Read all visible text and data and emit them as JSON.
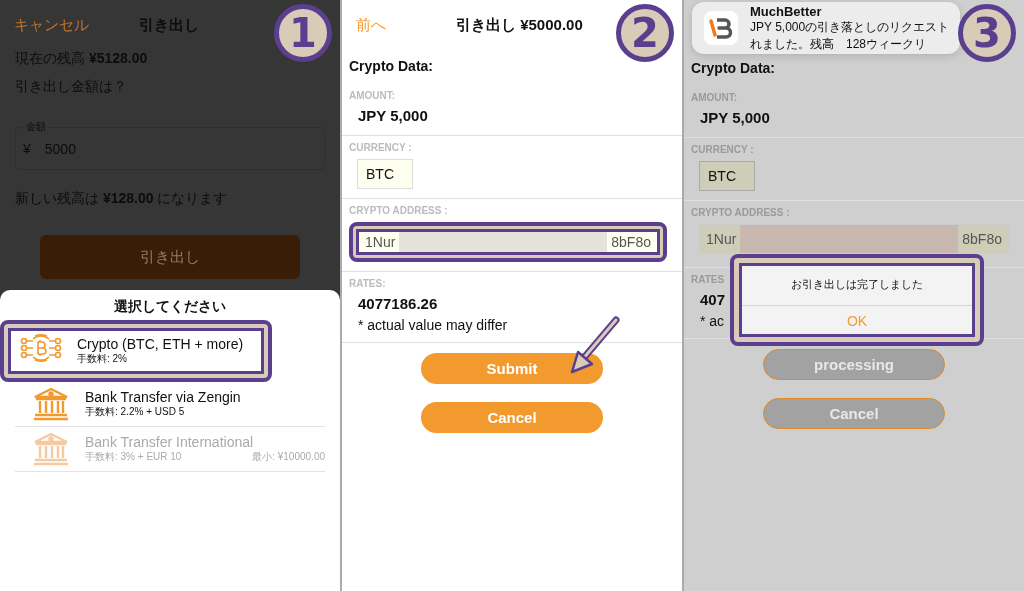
{
  "panels": [
    {
      "kind": "amount",
      "step": "1",
      "dimmed": true,
      "header": {
        "left": "キャンセル",
        "title": "引き出し"
      },
      "balance": "現在の残高 **¥5128.00**",
      "question": "引き出し金額は？",
      "amount_field": {
        "label": "金額",
        "currency": "¥",
        "value": "5000"
      },
      "new_balance": "新しい残高は **¥128.00** になります",
      "button": "引き出し",
      "sheet": {
        "title": "選択してください",
        "options": [
          {
            "kind": "crypto",
            "name": "Crypto (BTC, ETH + more)",
            "fee": "手数料: 2%",
            "disabled": false,
            "highlighted": true
          },
          {
            "kind": "bank",
            "name": "Bank Transfer via Zengin",
            "fee": "手数料: 2.2% + USD 5",
            "disabled": false,
            "highlighted": false
          },
          {
            "kind": "bank",
            "name": "Bank Transfer International",
            "fee": "手数料: 3% + EUR 10",
            "minimum": "最小: ¥10000.00",
            "disabled": true,
            "highlighted": false
          }
        ]
      }
    },
    {
      "kind": "form",
      "step": "2",
      "dimmed": false,
      "pointer": true,
      "header": {
        "left": "前へ",
        "title": "引き出し ¥5000.00"
      },
      "heading": "Crypto Data:",
      "fields": [
        {
          "kind": "text",
          "label": "AMOUNT:",
          "value": "JPY 5,000"
        },
        {
          "kind": "box",
          "label": "CURRENCY :",
          "value": "BTC"
        },
        {
          "kind": "address",
          "label": "CRYPTO ADDRESS :",
          "start": "1Nur",
          "end": "8bF8o",
          "highlighted": true
        },
        {
          "kind": "rates",
          "label": "RATES:",
          "value": "4077186.26",
          "note": "* actual value may differ"
        }
      ],
      "buttons": [
        {
          "label": "Submit",
          "disabled": false
        },
        {
          "label": "Cancel",
          "disabled": false
        }
      ]
    },
    {
      "kind": "form",
      "step": "3",
      "dimmed": true,
      "heading": "Crypto Data:",
      "notification": {
        "app": "MuchBetter",
        "lines": [
          "JPY 5,000の引き落としのリクエスト",
          "れました。残高　128ウィークリ"
        ]
      },
      "fields": [
        {
          "kind": "text",
          "label": "AMOUNT:",
          "value": "JPY 5,000"
        },
        {
          "kind": "box",
          "label": "CURRENCY :",
          "value": "BTC"
        },
        {
          "kind": "address",
          "label": "CRYPTO ADDRESS :",
          "start": "1Nur",
          "end": "8bF8o",
          "highlighted": false
        },
        {
          "kind": "rates",
          "label": "RATES",
          "value": "407",
          "note": "* ac"
        }
      ],
      "dialog": {
        "message": "お引き出しは完了しました",
        "button": "OK",
        "highlighted": true
      },
      "buttons": [
        {
          "label": "processing"
        },
        {
          "label": "Cancel"
        }
      ]
    }
  ]
}
